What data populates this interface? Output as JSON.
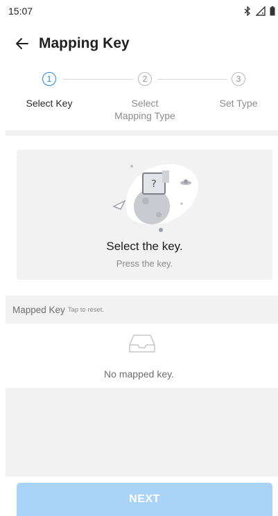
{
  "status_bar": {
    "time": "15:07",
    "icons": [
      "bluetooth-icon",
      "signal-icon",
      "battery-icon"
    ]
  },
  "app_bar": {
    "back_icon": "arrow-left-icon",
    "title": "Mapping Key"
  },
  "stepper": {
    "steps": [
      {
        "number": "1",
        "label": "Select Key",
        "active": true
      },
      {
        "number": "2",
        "label": "Select Mapping Type",
        "active": false
      },
      {
        "number": "3",
        "label": "Set Type",
        "active": false
      }
    ]
  },
  "key_card": {
    "title": "Select the key.",
    "subtitle": "Press the key."
  },
  "mapped_key": {
    "title": "Mapped Key",
    "hint": "Tap to reset.",
    "empty_text": "No mapped key."
  },
  "footer": {
    "next_label": "NEXT"
  },
  "colors": {
    "accent": "#1e88e5",
    "button_disabled": "#a9d3f7",
    "panel": "#f2f2f3"
  }
}
